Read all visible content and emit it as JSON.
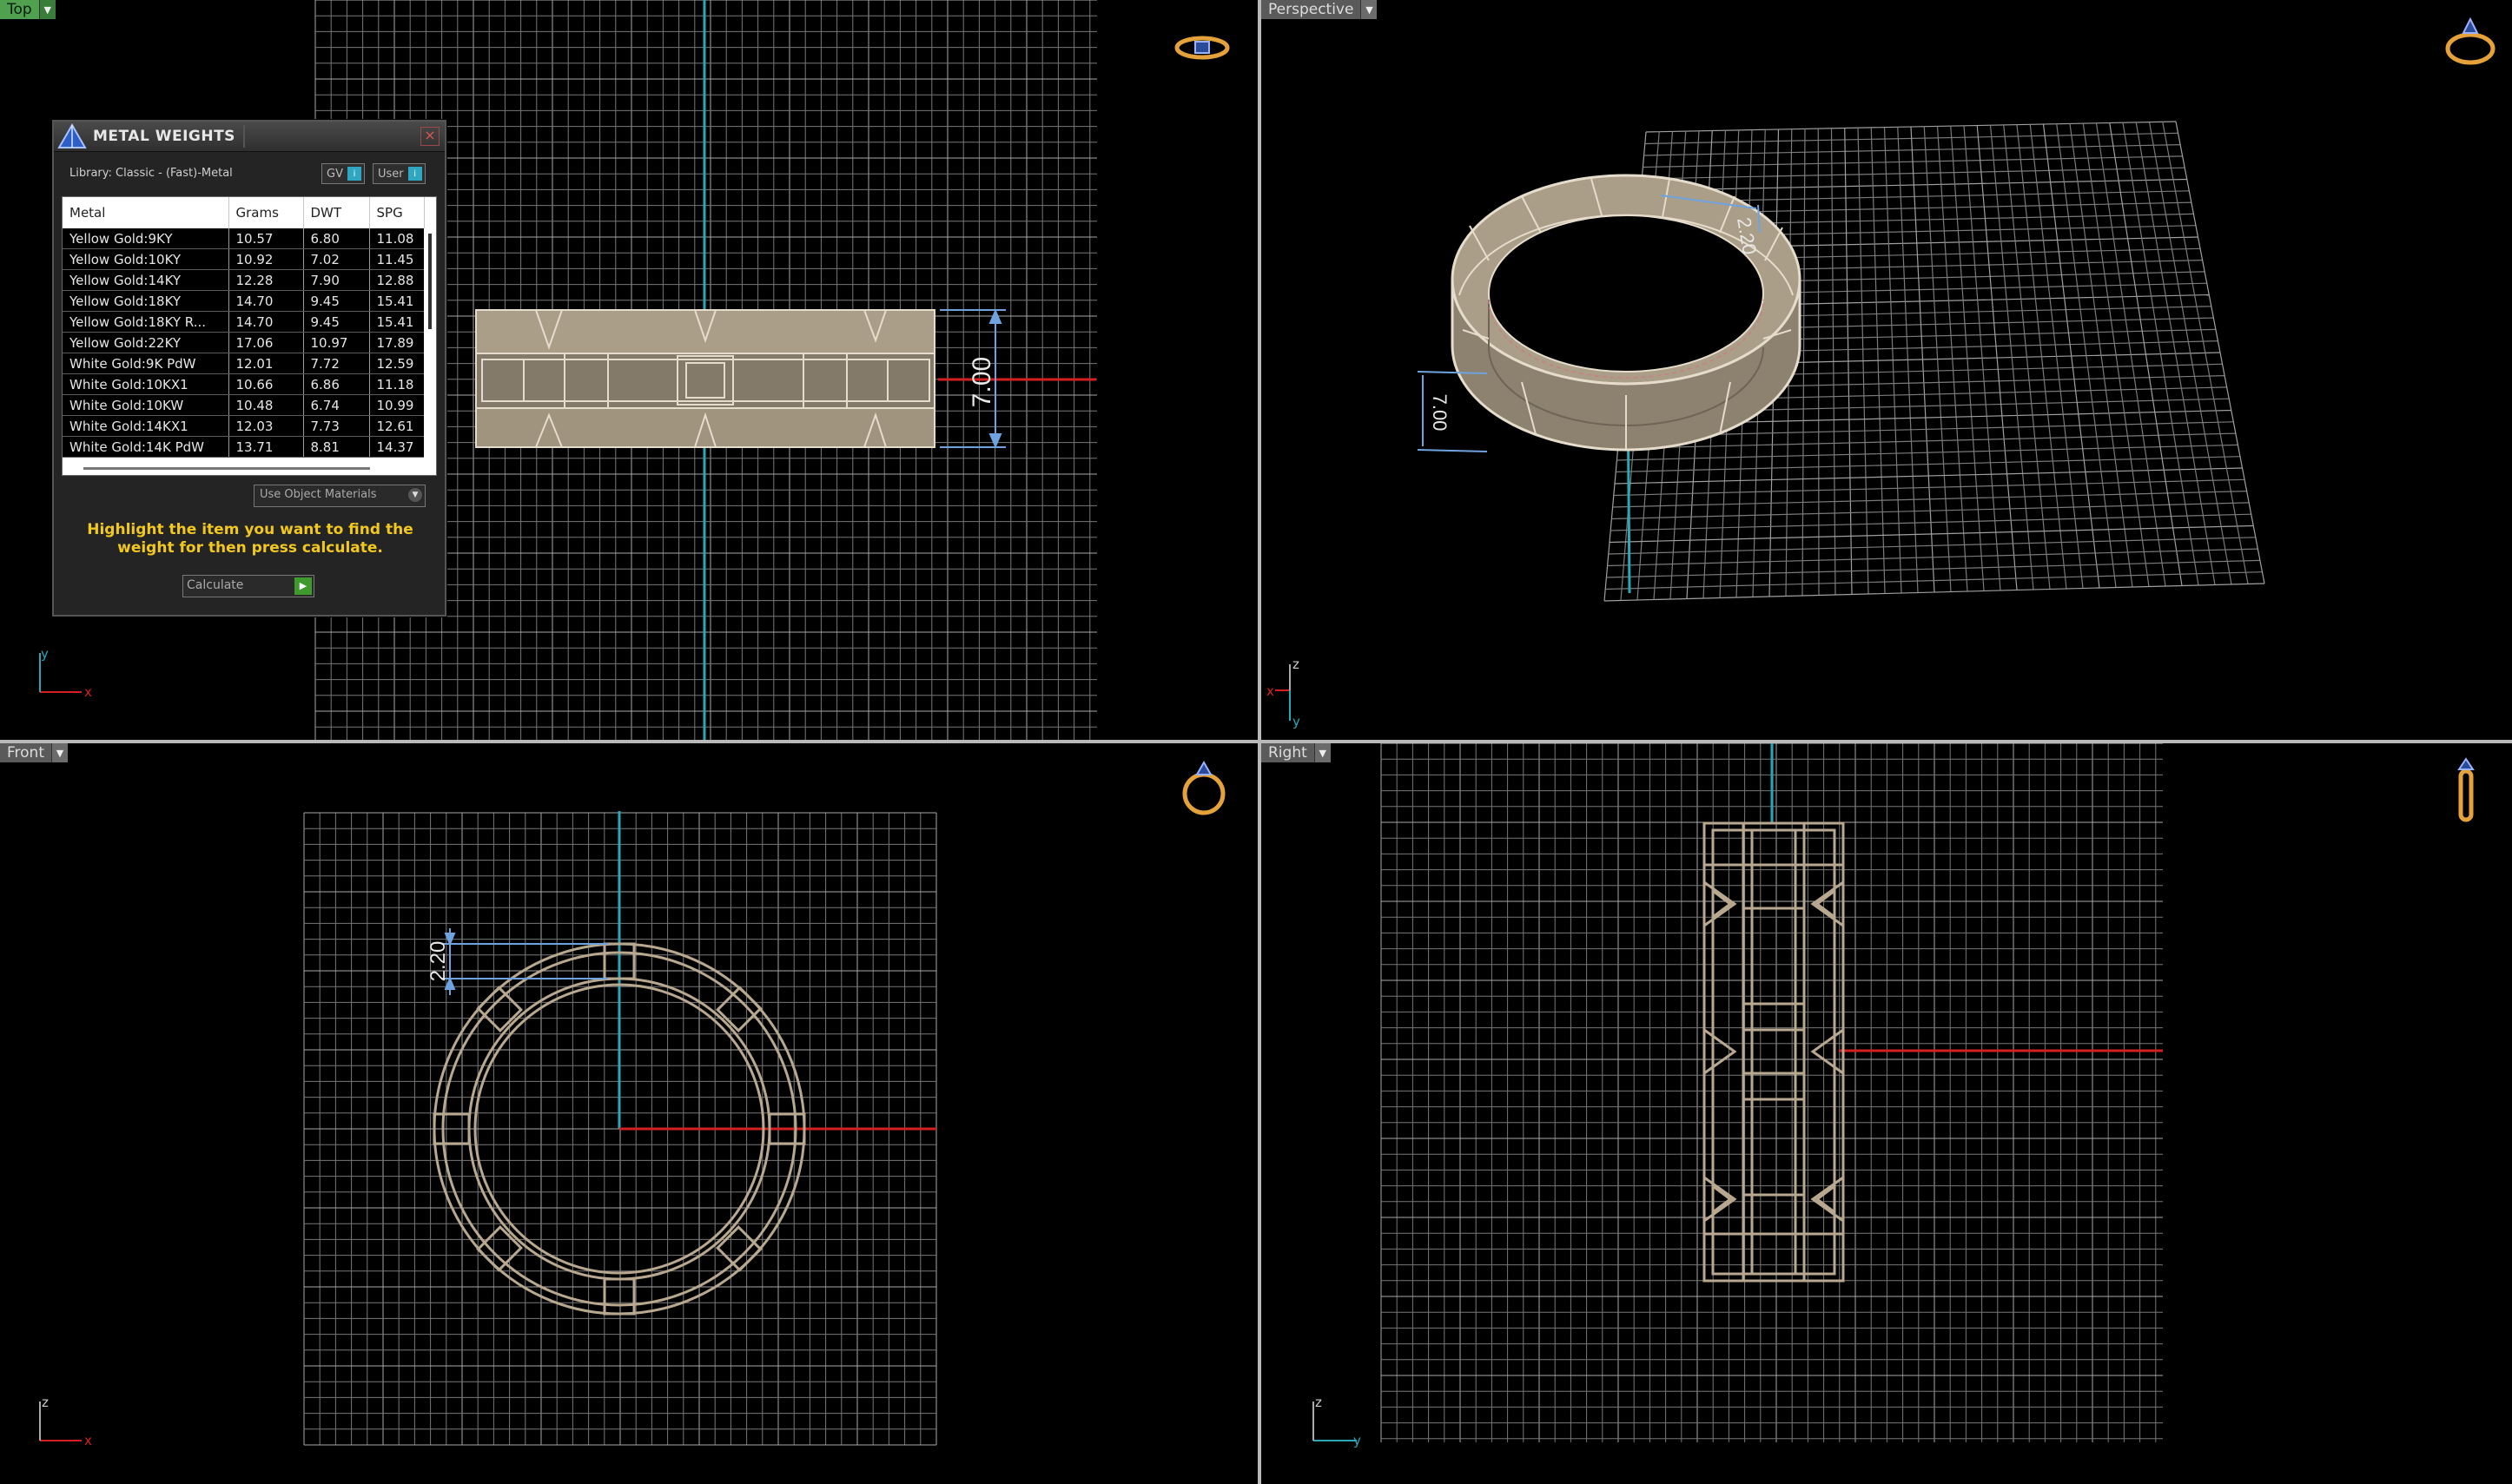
{
  "viewports": {
    "top": {
      "label": "Top",
      "dimension": "7.00",
      "axis_h": "x",
      "axis_v": "y"
    },
    "perspective": {
      "label": "Perspective",
      "dimension_a": "2.20",
      "dimension_b": "7.00",
      "axis_h": "x",
      "axis_v": "z",
      "axis_d": "y"
    },
    "front": {
      "label": "Front",
      "dimension": "2.20",
      "axis_h": "x",
      "axis_v": "z"
    },
    "right": {
      "label": "Right",
      "axis_h": "y",
      "axis_v": "z"
    }
  },
  "panel": {
    "title": "METAL WEIGHTS",
    "library": "Library: Classic - (Fast)-Metal",
    "btn_gv": "GV",
    "btn_user": "User",
    "columns": [
      "Metal",
      "Grams",
      "DWT",
      "SPG"
    ],
    "rows": [
      [
        "Yellow Gold:9KY",
        "10.57",
        "6.80",
        "11.08"
      ],
      [
        "Yellow Gold:10KY",
        "10.92",
        "7.02",
        "11.45"
      ],
      [
        "Yellow Gold:14KY",
        "12.28",
        "7.90",
        "12.88"
      ],
      [
        "Yellow Gold:18KY",
        "14.70",
        "9.45",
        "15.41"
      ],
      [
        "Yellow Gold:18KY R...",
        "14.70",
        "9.45",
        "15.41"
      ],
      [
        "Yellow Gold:22KY",
        "17.06",
        "10.97",
        "17.89"
      ],
      [
        "White Gold:9K PdW",
        "12.01",
        "7.72",
        "12.59"
      ],
      [
        "White Gold:10KX1",
        "10.66",
        "6.86",
        "11.18"
      ],
      [
        "White Gold:10KW",
        "10.48",
        "6.74",
        "10.99"
      ],
      [
        "White Gold:14KX1",
        "12.03",
        "7.73",
        "12.61"
      ],
      [
        "White Gold:14K PdW",
        "13.71",
        "8.81",
        "14.37"
      ]
    ],
    "material_select": "Use Object Materials",
    "hint": "Highlight the item you want to find the weight for then press calculate.",
    "calculate": "Calculate"
  },
  "colors": {
    "x_axis": "#d42020",
    "y_axis": "#2aa8b8",
    "grid": "#7a7a7a",
    "model": "#b8a890",
    "dimension": "#6fa3e0",
    "hint": "#f2c81e"
  }
}
